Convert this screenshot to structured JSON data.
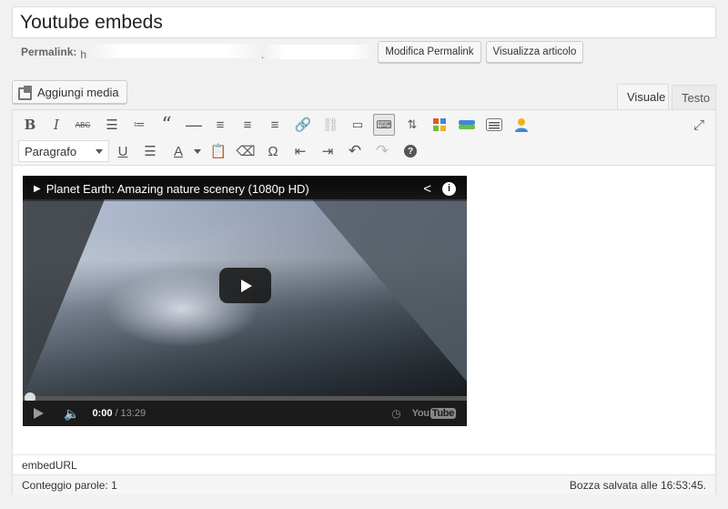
{
  "post": {
    "title": "Youtube embeds"
  },
  "permalink": {
    "label": "Permalink:",
    "url_prefix": "h",
    "url_suffix": ".",
    "edit_button": "Modifica Permalink",
    "view_button": "Visualizza articolo"
  },
  "media": {
    "add_button": "Aggiungi media"
  },
  "editor_tabs": [
    {
      "label": "Visuale",
      "active": true
    },
    {
      "label": "Testo",
      "active": false
    }
  ],
  "toolbar": {
    "format_select": "Paragrafo",
    "row1_icons": [
      "bold-icon",
      "italic-icon",
      "strikethrough-icon",
      "bullet-list-icon",
      "numbered-list-icon",
      "blockquote-icon",
      "horizontal-rule-icon",
      "align-left-icon",
      "align-center-icon",
      "align-right-icon",
      "insert-link-icon",
      "remove-link-icon",
      "read-more-icon",
      "toolbar-toggle-icon",
      "upload-icon",
      "plugin-grid-icon",
      "plugin-bar-icon",
      "plugin-list-icon",
      "plugin-user-icon",
      "fullscreen-icon"
    ],
    "row2_icons": [
      "underline-icon",
      "justify-icon",
      "text-color-icon",
      "paste-text-icon",
      "clear-formatting-icon",
      "special-character-icon",
      "outdent-icon",
      "indent-icon",
      "undo-icon",
      "redo-icon",
      "help-icon"
    ]
  },
  "video": {
    "title": "Planet Earth: Amazing nature scenery (1080p HD)",
    "current_time": "0:00",
    "separator": "/",
    "duration": "13:29",
    "progress": 0,
    "logo_you": "You",
    "logo_tube": "Tube"
  },
  "editor_status": {
    "path": "embedURL",
    "word_count": "Conteggio parole: 1",
    "draft_saved": "Bozza salvata alle 16:53:45."
  }
}
